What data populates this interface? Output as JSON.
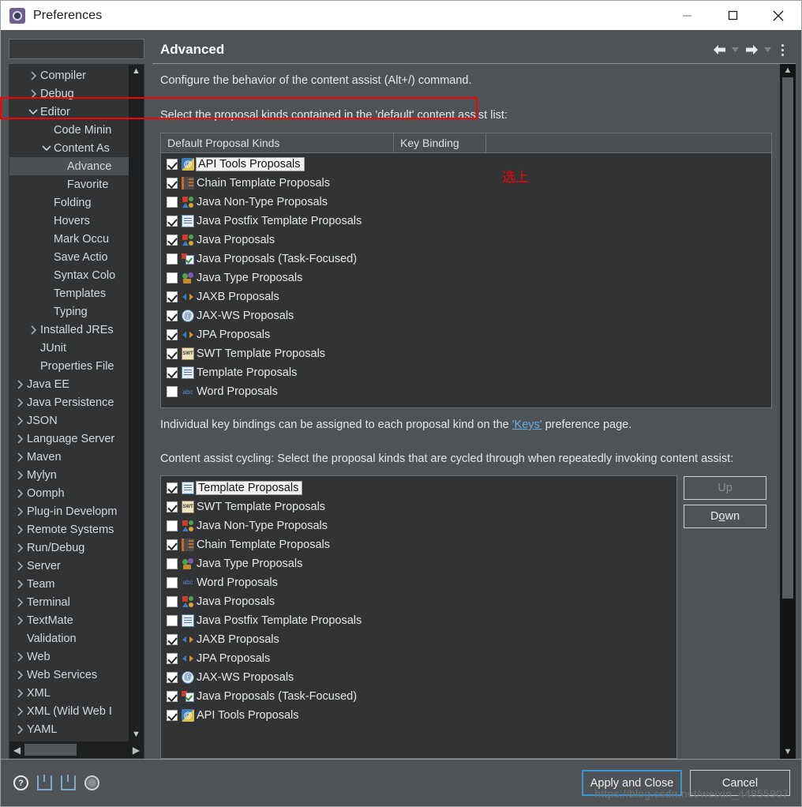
{
  "window": {
    "title": "Preferences",
    "icon": "preferences-gear-icon",
    "controls": {
      "minimize": "minimize-icon",
      "maximize": "maximize-icon",
      "close": "close-icon"
    }
  },
  "sidebar": {
    "filter": {
      "value": "",
      "placeholder": ""
    },
    "items": [
      {
        "label": "Compiler",
        "indent": 1,
        "twisty": "collapsed",
        "selected": false
      },
      {
        "label": "Debug",
        "indent": 1,
        "twisty": "collapsed",
        "selected": false
      },
      {
        "label": "Editor",
        "indent": 1,
        "twisty": "expanded",
        "selected": false
      },
      {
        "label": "Code Minin",
        "indent": 2,
        "twisty": "none",
        "selected": false
      },
      {
        "label": "Content As",
        "indent": 2,
        "twisty": "expanded",
        "selected": false
      },
      {
        "label": "Advance",
        "indent": 3,
        "twisty": "none",
        "selected": true
      },
      {
        "label": "Favorite",
        "indent": 3,
        "twisty": "none",
        "selected": false
      },
      {
        "label": "Folding",
        "indent": 2,
        "twisty": "none",
        "selected": false
      },
      {
        "label": "Hovers",
        "indent": 2,
        "twisty": "none",
        "selected": false
      },
      {
        "label": "Mark Occu",
        "indent": 2,
        "twisty": "none",
        "selected": false
      },
      {
        "label": "Save Actio",
        "indent": 2,
        "twisty": "none",
        "selected": false
      },
      {
        "label": "Syntax Colo",
        "indent": 2,
        "twisty": "none",
        "selected": false
      },
      {
        "label": "Templates",
        "indent": 2,
        "twisty": "none",
        "selected": false
      },
      {
        "label": "Typing",
        "indent": 2,
        "twisty": "none",
        "selected": false
      },
      {
        "label": "Installed JREs",
        "indent": 1,
        "twisty": "collapsed",
        "selected": false
      },
      {
        "label": "JUnit",
        "indent": 1,
        "twisty": "none",
        "selected": false
      },
      {
        "label": "Properties File",
        "indent": 1,
        "twisty": "none",
        "selected": false
      },
      {
        "label": "Java EE",
        "indent": 0,
        "twisty": "collapsed",
        "selected": false
      },
      {
        "label": "Java Persistence",
        "indent": 0,
        "twisty": "collapsed",
        "selected": false
      },
      {
        "label": "JSON",
        "indent": 0,
        "twisty": "collapsed",
        "selected": false
      },
      {
        "label": "Language Server",
        "indent": 0,
        "twisty": "collapsed",
        "selected": false
      },
      {
        "label": "Maven",
        "indent": 0,
        "twisty": "collapsed",
        "selected": false
      },
      {
        "label": "Mylyn",
        "indent": 0,
        "twisty": "collapsed",
        "selected": false
      },
      {
        "label": "Oomph",
        "indent": 0,
        "twisty": "collapsed",
        "selected": false
      },
      {
        "label": "Plug-in Developm",
        "indent": 0,
        "twisty": "collapsed",
        "selected": false
      },
      {
        "label": "Remote Systems",
        "indent": 0,
        "twisty": "collapsed",
        "selected": false
      },
      {
        "label": "Run/Debug",
        "indent": 0,
        "twisty": "collapsed",
        "selected": false
      },
      {
        "label": "Server",
        "indent": 0,
        "twisty": "collapsed",
        "selected": false
      },
      {
        "label": "Team",
        "indent": 0,
        "twisty": "collapsed",
        "selected": false
      },
      {
        "label": "Terminal",
        "indent": 0,
        "twisty": "collapsed",
        "selected": false
      },
      {
        "label": "TextMate",
        "indent": 0,
        "twisty": "collapsed",
        "selected": false
      },
      {
        "label": "Validation",
        "indent": 0,
        "twisty": "none",
        "selected": false
      },
      {
        "label": "Web",
        "indent": 0,
        "twisty": "collapsed",
        "selected": false
      },
      {
        "label": "Web Services",
        "indent": 0,
        "twisty": "collapsed",
        "selected": false
      },
      {
        "label": "XML",
        "indent": 0,
        "twisty": "collapsed",
        "selected": false
      },
      {
        "label": "XML (Wild Web I",
        "indent": 0,
        "twisty": "collapsed",
        "selected": false
      },
      {
        "label": "YAML",
        "indent": 0,
        "twisty": "collapsed",
        "selected": false
      }
    ]
  },
  "page": {
    "title": "Advanced",
    "nav": {
      "back": "back-arrow-icon",
      "forward": "forward-arrow-icon",
      "menu": "view-menu-icon"
    },
    "description": "Configure the behavior of the content assist (Alt+/) command.",
    "default_list_label": "Select the proposal kinds contained in the 'default' content assist list:",
    "table_headers": [
      "Default Proposal Kinds",
      "Key Binding"
    ],
    "default_proposals": [
      {
        "label": "API Tools Proposals",
        "checked": true,
        "icon": "api-tools-icon",
        "highlight": true
      },
      {
        "label": "Chain Template Proposals",
        "checked": true,
        "icon": "chain-template-icon",
        "highlight": false
      },
      {
        "label": "Java Non-Type Proposals",
        "checked": false,
        "icon": "java-nontype-icon",
        "highlight": false
      },
      {
        "label": "Java Postfix Template Proposals",
        "checked": true,
        "icon": "document-icon",
        "highlight": false
      },
      {
        "label": "Java Proposals",
        "checked": true,
        "icon": "java-nontype-icon",
        "highlight": false
      },
      {
        "label": "Java Proposals (Task-Focused)",
        "checked": false,
        "icon": "task-focused-icon",
        "highlight": false
      },
      {
        "label": "Java Type Proposals",
        "checked": false,
        "icon": "java-type-icon",
        "highlight": false
      },
      {
        "label": "JAXB Proposals",
        "checked": true,
        "icon": "arrows-icon",
        "highlight": false
      },
      {
        "label": "JAX-WS Proposals",
        "checked": true,
        "icon": "jaxws-icon",
        "highlight": false
      },
      {
        "label": "JPA Proposals",
        "checked": true,
        "icon": "arrows-icon",
        "highlight": false
      },
      {
        "label": "SWT Template Proposals",
        "checked": true,
        "icon": "swt-icon",
        "highlight": false
      },
      {
        "label": "Template Proposals",
        "checked": true,
        "icon": "document-icon",
        "highlight": false
      },
      {
        "label": "Word Proposals",
        "checked": false,
        "icon": "word-icon",
        "highlight": false
      }
    ],
    "keys_text_before": "Individual key bindings can be assigned to each proposal kind on the ",
    "keys_link": "'Keys'",
    "keys_text_after": " preference page.",
    "cycling_label": "Content assist cycling: Select the proposal kinds that are cycled through when repeatedly invoking content assist:",
    "cycling_proposals": [
      {
        "label": "Template Proposals",
        "checked": true,
        "icon": "document-icon",
        "highlight": true
      },
      {
        "label": "SWT Template Proposals",
        "checked": true,
        "icon": "swt-icon",
        "highlight": false
      },
      {
        "label": "Java Non-Type Proposals",
        "checked": false,
        "icon": "java-nontype-icon",
        "highlight": false
      },
      {
        "label": "Chain Template Proposals",
        "checked": true,
        "icon": "chain-template-icon",
        "highlight": false
      },
      {
        "label": "Java Type Proposals",
        "checked": false,
        "icon": "java-type-icon",
        "highlight": false
      },
      {
        "label": "Word Proposals",
        "checked": false,
        "icon": "word-icon",
        "highlight": false
      },
      {
        "label": "Java Proposals",
        "checked": false,
        "icon": "java-nontype-icon",
        "highlight": false
      },
      {
        "label": "Java Postfix Template Proposals",
        "checked": false,
        "icon": "document-icon",
        "highlight": false
      },
      {
        "label": "JAXB Proposals",
        "checked": true,
        "icon": "arrows-icon",
        "highlight": false
      },
      {
        "label": "JPA Proposals",
        "checked": true,
        "icon": "arrows-icon",
        "highlight": false
      },
      {
        "label": "JAX-WS Proposals",
        "checked": true,
        "icon": "jaxws-icon",
        "highlight": false
      },
      {
        "label": "Java Proposals (Task-Focused)",
        "checked": true,
        "icon": "task-focused-icon",
        "highlight": false
      },
      {
        "label": "API Tools Proposals",
        "checked": true,
        "icon": "api-tools-icon",
        "highlight": false
      }
    ],
    "up_button": {
      "label": "Up",
      "enabled": false
    },
    "down_button": {
      "label": "Down",
      "enabled": true,
      "mnemonic_index": 1
    }
  },
  "annotation": {
    "note_text": "选上",
    "color": "#fa0000",
    "target_row": "Java Proposals"
  },
  "footer": {
    "icons": [
      "help-icon",
      "import-icon",
      "export-icon",
      "restore-defaults-icon"
    ],
    "apply_and_close": "Apply and Close",
    "cancel": "Cancel"
  },
  "watermark": "https://blog.csdn.net/weixin_44855907"
}
